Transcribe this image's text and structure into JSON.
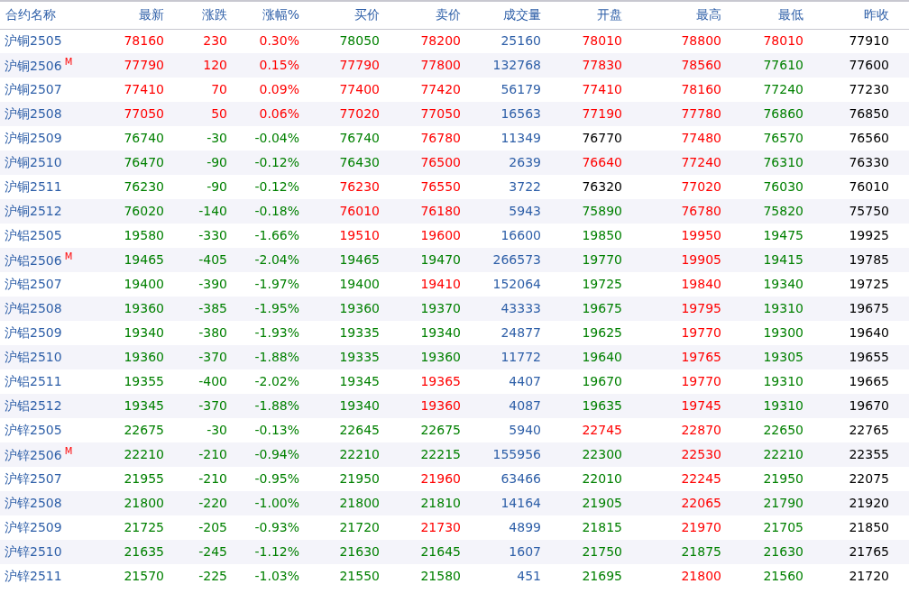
{
  "table": {
    "columns": [
      "合约名称",
      "最新",
      "涨跌",
      "涨幅%",
      "买价",
      "卖价",
      "成交量",
      "开盘",
      "最高",
      "最低",
      "昨收"
    ],
    "rows": [
      {
        "cells": [
          {
            "text": "沪铜2505"
          },
          {
            "text": "78160",
            "color": "#ff0000"
          },
          {
            "text": "230",
            "color": "#ff0000"
          },
          {
            "text": "0.30%",
            "color": "#ff0000"
          },
          {
            "text": "78050",
            "color": "#008000"
          },
          {
            "text": "78200",
            "color": "#ff0000"
          },
          {
            "text": "25160",
            "color": "#2e5fa8"
          },
          {
            "text": "78010",
            "color": "#ff0000"
          },
          {
            "text": "78800",
            "color": "#ff0000"
          },
          {
            "text": "78010",
            "color": "#ff0000"
          },
          {
            "text": "77910",
            "color": "#000000"
          }
        ]
      },
      {
        "cells": [
          {
            "text": "沪铜2506",
            "marker": "M"
          },
          {
            "text": "77790",
            "color": "#ff0000"
          },
          {
            "text": "120",
            "color": "#ff0000"
          },
          {
            "text": "0.15%",
            "color": "#ff0000"
          },
          {
            "text": "77790",
            "color": "#ff0000"
          },
          {
            "text": "77800",
            "color": "#ff0000"
          },
          {
            "text": "132768",
            "color": "#2e5fa8"
          },
          {
            "text": "77830",
            "color": "#ff0000"
          },
          {
            "text": "78560",
            "color": "#ff0000"
          },
          {
            "text": "77610",
            "color": "#008000"
          },
          {
            "text": "77600",
            "color": "#000000"
          }
        ]
      },
      {
        "cells": [
          {
            "text": "沪铜2507"
          },
          {
            "text": "77410",
            "color": "#ff0000"
          },
          {
            "text": "70",
            "color": "#ff0000"
          },
          {
            "text": "0.09%",
            "color": "#ff0000"
          },
          {
            "text": "77400",
            "color": "#ff0000"
          },
          {
            "text": "77420",
            "color": "#ff0000"
          },
          {
            "text": "56179",
            "color": "#2e5fa8"
          },
          {
            "text": "77410",
            "color": "#ff0000"
          },
          {
            "text": "78160",
            "color": "#ff0000"
          },
          {
            "text": "77240",
            "color": "#008000"
          },
          {
            "text": "77230",
            "color": "#000000"
          }
        ]
      },
      {
        "cells": [
          {
            "text": "沪铜2508"
          },
          {
            "text": "77050",
            "color": "#ff0000"
          },
          {
            "text": "50",
            "color": "#ff0000"
          },
          {
            "text": "0.06%",
            "color": "#ff0000"
          },
          {
            "text": "77020",
            "color": "#ff0000"
          },
          {
            "text": "77050",
            "color": "#ff0000"
          },
          {
            "text": "16563",
            "color": "#2e5fa8"
          },
          {
            "text": "77190",
            "color": "#ff0000"
          },
          {
            "text": "77780",
            "color": "#ff0000"
          },
          {
            "text": "76860",
            "color": "#008000"
          },
          {
            "text": "76850",
            "color": "#000000"
          }
        ]
      },
      {
        "cells": [
          {
            "text": "沪铜2509"
          },
          {
            "text": "76740",
            "color": "#008000"
          },
          {
            "text": "-30",
            "color": "#008000"
          },
          {
            "text": "-0.04%",
            "color": "#008000"
          },
          {
            "text": "76740",
            "color": "#008000"
          },
          {
            "text": "76780",
            "color": "#ff0000"
          },
          {
            "text": "11349",
            "color": "#2e5fa8"
          },
          {
            "text": "76770",
            "color": "#000000"
          },
          {
            "text": "77480",
            "color": "#ff0000"
          },
          {
            "text": "76570",
            "color": "#008000"
          },
          {
            "text": "76560",
            "color": "#000000"
          }
        ]
      },
      {
        "cells": [
          {
            "text": "沪铜2510"
          },
          {
            "text": "76470",
            "color": "#008000"
          },
          {
            "text": "-90",
            "color": "#008000"
          },
          {
            "text": "-0.12%",
            "color": "#008000"
          },
          {
            "text": "76430",
            "color": "#008000"
          },
          {
            "text": "76500",
            "color": "#ff0000"
          },
          {
            "text": "2639",
            "color": "#2e5fa8"
          },
          {
            "text": "76640",
            "color": "#ff0000"
          },
          {
            "text": "77240",
            "color": "#ff0000"
          },
          {
            "text": "76310",
            "color": "#008000"
          },
          {
            "text": "76330",
            "color": "#000000"
          }
        ]
      },
      {
        "cells": [
          {
            "text": "沪铜2511"
          },
          {
            "text": "76230",
            "color": "#008000"
          },
          {
            "text": "-90",
            "color": "#008000"
          },
          {
            "text": "-0.12%",
            "color": "#008000"
          },
          {
            "text": "76230",
            "color": "#ff0000"
          },
          {
            "text": "76550",
            "color": "#ff0000"
          },
          {
            "text": "3722",
            "color": "#2e5fa8"
          },
          {
            "text": "76320",
            "color": "#000000"
          },
          {
            "text": "77020",
            "color": "#ff0000"
          },
          {
            "text": "76030",
            "color": "#008000"
          },
          {
            "text": "76010",
            "color": "#000000"
          }
        ]
      },
      {
        "cells": [
          {
            "text": "沪铜2512"
          },
          {
            "text": "76020",
            "color": "#008000"
          },
          {
            "text": "-140",
            "color": "#008000"
          },
          {
            "text": "-0.18%",
            "color": "#008000"
          },
          {
            "text": "76010",
            "color": "#ff0000"
          },
          {
            "text": "76180",
            "color": "#ff0000"
          },
          {
            "text": "5943",
            "color": "#2e5fa8"
          },
          {
            "text": "75890",
            "color": "#008000"
          },
          {
            "text": "76780",
            "color": "#ff0000"
          },
          {
            "text": "75820",
            "color": "#008000"
          },
          {
            "text": "75750",
            "color": "#000000"
          }
        ]
      },
      {
        "cells": [
          {
            "text": "沪铝2505"
          },
          {
            "text": "19580",
            "color": "#008000"
          },
          {
            "text": "-330",
            "color": "#008000"
          },
          {
            "text": "-1.66%",
            "color": "#008000"
          },
          {
            "text": "19510",
            "color": "#ff0000"
          },
          {
            "text": "19600",
            "color": "#ff0000"
          },
          {
            "text": "16600",
            "color": "#2e5fa8"
          },
          {
            "text": "19850",
            "color": "#008000"
          },
          {
            "text": "19950",
            "color": "#ff0000"
          },
          {
            "text": "19475",
            "color": "#008000"
          },
          {
            "text": "19925",
            "color": "#000000"
          }
        ]
      },
      {
        "cells": [
          {
            "text": "沪铝2506",
            "marker": "M"
          },
          {
            "text": "19465",
            "color": "#008000"
          },
          {
            "text": "-405",
            "color": "#008000"
          },
          {
            "text": "-2.04%",
            "color": "#008000"
          },
          {
            "text": "19465",
            "color": "#008000"
          },
          {
            "text": "19470",
            "color": "#008000"
          },
          {
            "text": "266573",
            "color": "#2e5fa8"
          },
          {
            "text": "19770",
            "color": "#008000"
          },
          {
            "text": "19905",
            "color": "#ff0000"
          },
          {
            "text": "19415",
            "color": "#008000"
          },
          {
            "text": "19785",
            "color": "#000000"
          }
        ]
      },
      {
        "cells": [
          {
            "text": "沪铝2507"
          },
          {
            "text": "19400",
            "color": "#008000"
          },
          {
            "text": "-390",
            "color": "#008000"
          },
          {
            "text": "-1.97%",
            "color": "#008000"
          },
          {
            "text": "19400",
            "color": "#008000"
          },
          {
            "text": "19410",
            "color": "#ff0000"
          },
          {
            "text": "152064",
            "color": "#2e5fa8"
          },
          {
            "text": "19725",
            "color": "#008000"
          },
          {
            "text": "19840",
            "color": "#ff0000"
          },
          {
            "text": "19340",
            "color": "#008000"
          },
          {
            "text": "19725",
            "color": "#000000"
          }
        ]
      },
      {
        "cells": [
          {
            "text": "沪铝2508"
          },
          {
            "text": "19360",
            "color": "#008000"
          },
          {
            "text": "-385",
            "color": "#008000"
          },
          {
            "text": "-1.95%",
            "color": "#008000"
          },
          {
            "text": "19360",
            "color": "#008000"
          },
          {
            "text": "19370",
            "color": "#008000"
          },
          {
            "text": "43333",
            "color": "#2e5fa8"
          },
          {
            "text": "19675",
            "color": "#008000"
          },
          {
            "text": "19795",
            "color": "#ff0000"
          },
          {
            "text": "19310",
            "color": "#008000"
          },
          {
            "text": "19675",
            "color": "#000000"
          }
        ]
      },
      {
        "cells": [
          {
            "text": "沪铝2509"
          },
          {
            "text": "19340",
            "color": "#008000"
          },
          {
            "text": "-380",
            "color": "#008000"
          },
          {
            "text": "-1.93%",
            "color": "#008000"
          },
          {
            "text": "19335",
            "color": "#008000"
          },
          {
            "text": "19340",
            "color": "#008000"
          },
          {
            "text": "24877",
            "color": "#2e5fa8"
          },
          {
            "text": "19625",
            "color": "#008000"
          },
          {
            "text": "19770",
            "color": "#ff0000"
          },
          {
            "text": "19300",
            "color": "#008000"
          },
          {
            "text": "19640",
            "color": "#000000"
          }
        ]
      },
      {
        "cells": [
          {
            "text": "沪铝2510"
          },
          {
            "text": "19360",
            "color": "#008000"
          },
          {
            "text": "-370",
            "color": "#008000"
          },
          {
            "text": "-1.88%",
            "color": "#008000"
          },
          {
            "text": "19335",
            "color": "#008000"
          },
          {
            "text": "19360",
            "color": "#008000"
          },
          {
            "text": "11772",
            "color": "#2e5fa8"
          },
          {
            "text": "19640",
            "color": "#008000"
          },
          {
            "text": "19765",
            "color": "#ff0000"
          },
          {
            "text": "19305",
            "color": "#008000"
          },
          {
            "text": "19655",
            "color": "#000000"
          }
        ]
      },
      {
        "cells": [
          {
            "text": "沪铝2511"
          },
          {
            "text": "19355",
            "color": "#008000"
          },
          {
            "text": "-400",
            "color": "#008000"
          },
          {
            "text": "-2.02%",
            "color": "#008000"
          },
          {
            "text": "19345",
            "color": "#008000"
          },
          {
            "text": "19365",
            "color": "#ff0000"
          },
          {
            "text": "4407",
            "color": "#2e5fa8"
          },
          {
            "text": "19670",
            "color": "#008000"
          },
          {
            "text": "19770",
            "color": "#ff0000"
          },
          {
            "text": "19310",
            "color": "#008000"
          },
          {
            "text": "19665",
            "color": "#000000"
          }
        ]
      },
      {
        "cells": [
          {
            "text": "沪铝2512"
          },
          {
            "text": "19345",
            "color": "#008000"
          },
          {
            "text": "-370",
            "color": "#008000"
          },
          {
            "text": "-1.88%",
            "color": "#008000"
          },
          {
            "text": "19340",
            "color": "#008000"
          },
          {
            "text": "19360",
            "color": "#ff0000"
          },
          {
            "text": "4087",
            "color": "#2e5fa8"
          },
          {
            "text": "19635",
            "color": "#008000"
          },
          {
            "text": "19745",
            "color": "#ff0000"
          },
          {
            "text": "19310",
            "color": "#008000"
          },
          {
            "text": "19670",
            "color": "#000000"
          }
        ]
      },
      {
        "cells": [
          {
            "text": "沪锌2505"
          },
          {
            "text": "22675",
            "color": "#008000"
          },
          {
            "text": "-30",
            "color": "#008000"
          },
          {
            "text": "-0.13%",
            "color": "#008000"
          },
          {
            "text": "22645",
            "color": "#008000"
          },
          {
            "text": "22675",
            "color": "#008000"
          },
          {
            "text": "5940",
            "color": "#2e5fa8"
          },
          {
            "text": "22745",
            "color": "#ff0000"
          },
          {
            "text": "22870",
            "color": "#ff0000"
          },
          {
            "text": "22650",
            "color": "#008000"
          },
          {
            "text": "22765",
            "color": "#000000"
          }
        ]
      },
      {
        "cells": [
          {
            "text": "沪锌2506",
            "marker": "M"
          },
          {
            "text": "22210",
            "color": "#008000"
          },
          {
            "text": "-210",
            "color": "#008000"
          },
          {
            "text": "-0.94%",
            "color": "#008000"
          },
          {
            "text": "22210",
            "color": "#008000"
          },
          {
            "text": "22215",
            "color": "#008000"
          },
          {
            "text": "155956",
            "color": "#2e5fa8"
          },
          {
            "text": "22300",
            "color": "#008000"
          },
          {
            "text": "22530",
            "color": "#ff0000"
          },
          {
            "text": "22210",
            "color": "#008000"
          },
          {
            "text": "22355",
            "color": "#000000"
          }
        ]
      },
      {
        "cells": [
          {
            "text": "沪锌2507"
          },
          {
            "text": "21955",
            "color": "#008000"
          },
          {
            "text": "-210",
            "color": "#008000"
          },
          {
            "text": "-0.95%",
            "color": "#008000"
          },
          {
            "text": "21950",
            "color": "#008000"
          },
          {
            "text": "21960",
            "color": "#ff0000"
          },
          {
            "text": "63466",
            "color": "#2e5fa8"
          },
          {
            "text": "22010",
            "color": "#008000"
          },
          {
            "text": "22245",
            "color": "#ff0000"
          },
          {
            "text": "21950",
            "color": "#008000"
          },
          {
            "text": "22075",
            "color": "#000000"
          }
        ]
      },
      {
        "cells": [
          {
            "text": "沪锌2508"
          },
          {
            "text": "21800",
            "color": "#008000"
          },
          {
            "text": "-220",
            "color": "#008000"
          },
          {
            "text": "-1.00%",
            "color": "#008000"
          },
          {
            "text": "21800",
            "color": "#008000"
          },
          {
            "text": "21810",
            "color": "#008000"
          },
          {
            "text": "14164",
            "color": "#2e5fa8"
          },
          {
            "text": "21905",
            "color": "#008000"
          },
          {
            "text": "22065",
            "color": "#ff0000"
          },
          {
            "text": "21790",
            "color": "#008000"
          },
          {
            "text": "21920",
            "color": "#000000"
          }
        ]
      },
      {
        "cells": [
          {
            "text": "沪锌2509"
          },
          {
            "text": "21725",
            "color": "#008000"
          },
          {
            "text": "-205",
            "color": "#008000"
          },
          {
            "text": "-0.93%",
            "color": "#008000"
          },
          {
            "text": "21720",
            "color": "#008000"
          },
          {
            "text": "21730",
            "color": "#ff0000"
          },
          {
            "text": "4899",
            "color": "#2e5fa8"
          },
          {
            "text": "21815",
            "color": "#008000"
          },
          {
            "text": "21970",
            "color": "#ff0000"
          },
          {
            "text": "21705",
            "color": "#008000"
          },
          {
            "text": "21850",
            "color": "#000000"
          }
        ]
      },
      {
        "cells": [
          {
            "text": "沪锌2510"
          },
          {
            "text": "21635",
            "color": "#008000"
          },
          {
            "text": "-245",
            "color": "#008000"
          },
          {
            "text": "-1.12%",
            "color": "#008000"
          },
          {
            "text": "21630",
            "color": "#008000"
          },
          {
            "text": "21645",
            "color": "#008000"
          },
          {
            "text": "1607",
            "color": "#2e5fa8"
          },
          {
            "text": "21750",
            "color": "#008000"
          },
          {
            "text": "21875",
            "color": "#008000"
          },
          {
            "text": "21630",
            "color": "#008000"
          },
          {
            "text": "21765",
            "color": "#000000"
          }
        ]
      },
      {
        "cells": [
          {
            "text": "沪锌2511"
          },
          {
            "text": "21570",
            "color": "#008000"
          },
          {
            "text": "-225",
            "color": "#008000"
          },
          {
            "text": "-1.03%",
            "color": "#008000"
          },
          {
            "text": "21550",
            "color": "#008000"
          },
          {
            "text": "21580",
            "color": "#008000"
          },
          {
            "text": "451",
            "color": "#2e5fa8"
          },
          {
            "text": "21695",
            "color": "#008000"
          },
          {
            "text": "21800",
            "color": "#ff0000"
          },
          {
            "text": "21560",
            "color": "#008000"
          },
          {
            "text": "21720",
            "color": "#000000"
          }
        ]
      }
    ]
  }
}
